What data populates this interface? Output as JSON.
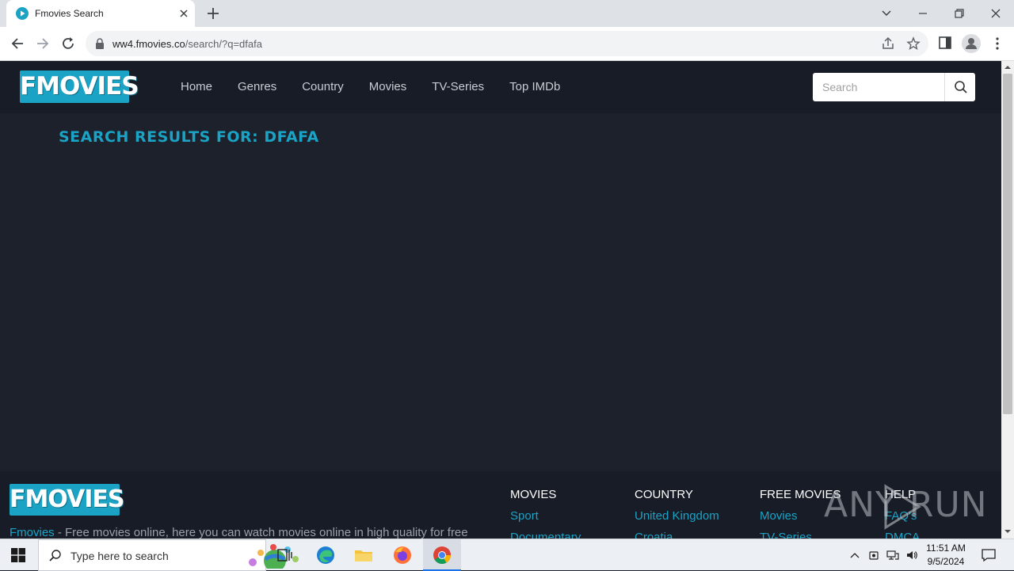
{
  "browser": {
    "tab_title": "Fmovies Search",
    "url_host": "ww4.fmovies.co",
    "url_path": "/search/?q=dfafa"
  },
  "site": {
    "logo_text": "FMOVIES",
    "nav": [
      "Home",
      "Genres",
      "Country",
      "Movies",
      "TV-Series",
      "Top IMDb"
    ],
    "search_placeholder": "Search",
    "results_title": "SEARCH RESULTS FOR: DFAFA"
  },
  "footer": {
    "logo_text": "FMOVIES",
    "brand": "Fmovies",
    "description": " - Free movies online, here you can watch movies online in high quality for free",
    "columns": [
      {
        "heading": "MOVIES",
        "links": [
          "Sport",
          "Documentary"
        ]
      },
      {
        "heading": "COUNTRY",
        "links": [
          "United Kingdom",
          "Croatia"
        ]
      },
      {
        "heading": "FREE MOVIES",
        "links": [
          "Movies",
          "TV-Series"
        ]
      },
      {
        "heading": "HELP",
        "links": [
          "FAQ's",
          "DMCA"
        ]
      }
    ]
  },
  "watermark": "ANY RUN",
  "taskbar": {
    "search_text": "Type here to search",
    "time": "11:51 AM",
    "date": "9/5/2024"
  },
  "colors": {
    "accent": "#1ba3c6",
    "page_bg": "#1c212c",
    "header_bg": "#171c26"
  }
}
